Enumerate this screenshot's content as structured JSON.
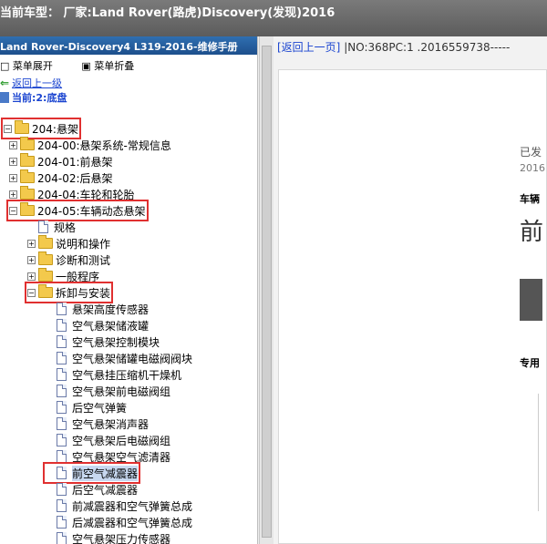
{
  "titlebar": {
    "text": "当前车型： 厂家:Land Rover(路虎)Discovery(发现)2016"
  },
  "left": {
    "header": "Land Rover-Discovery4 L319-2016-维修手册",
    "toolbar": {
      "expand": "菜单展开",
      "collapse": "菜单折叠"
    },
    "back_link": "返回上一级",
    "current": "当前:2:底盘",
    "tree": [
      {
        "label": "204:悬架",
        "type": "folder",
        "level": 0,
        "expanded": true
      },
      {
        "label": "204-00:悬架系统-常规信息",
        "type": "folder",
        "level": 1
      },
      {
        "label": "204-01:前悬架",
        "type": "folder",
        "level": 1
      },
      {
        "label": "204-02:后悬架",
        "type": "folder",
        "level": 1
      },
      {
        "label": "204-04:车轮和轮胎",
        "type": "folder",
        "level": 1
      },
      {
        "label": "204-05:车辆动态悬架",
        "type": "folder",
        "level": 1,
        "expanded": true
      },
      {
        "label": "规格",
        "type": "doc",
        "level": 2
      },
      {
        "label": "说明和操作",
        "type": "folder",
        "level": 2
      },
      {
        "label": "诊断和测试",
        "type": "folder",
        "level": 2
      },
      {
        "label": "一般程序",
        "type": "folder",
        "level": 2
      },
      {
        "label": "拆卸与安装",
        "type": "folder",
        "level": 2,
        "expanded": true
      },
      {
        "label": "悬架高度传感器",
        "type": "doc",
        "level": 3
      },
      {
        "label": "空气悬架储液罐",
        "type": "doc",
        "level": 3
      },
      {
        "label": "空气悬架控制模块",
        "type": "doc",
        "level": 3
      },
      {
        "label": "空气悬架储罐电磁阀阀块",
        "type": "doc",
        "level": 3
      },
      {
        "label": "空气悬挂压缩机干燥机",
        "type": "doc",
        "level": 3
      },
      {
        "label": "空气悬架前电磁阀组",
        "type": "doc",
        "level": 3
      },
      {
        "label": "后空气弹簧",
        "type": "doc",
        "level": 3
      },
      {
        "label": "空气悬架消声器",
        "type": "doc",
        "level": 3
      },
      {
        "label": "空气悬架后电磁阀组",
        "type": "doc",
        "level": 3
      },
      {
        "label": "空气悬架空气滤清器",
        "type": "doc",
        "level": 3
      },
      {
        "label": "前空气减震器",
        "type": "doc",
        "level": 3
      },
      {
        "label": "后空气减震器",
        "type": "doc",
        "level": 3
      },
      {
        "label": "前减震器和空气弹簧总成",
        "type": "doc",
        "level": 3
      },
      {
        "label": "后减震器和空气弹簧总成",
        "type": "doc",
        "level": 3
      },
      {
        "label": "空气悬架压力传感器",
        "type": "doc",
        "level": 3
      }
    ]
  },
  "right": {
    "back": "[返回上一页]",
    "info": "|NO:368PC:1 .2016559738-----",
    "p1": "已发",
    "p2": "2016",
    "p3": "车辆",
    "p4": "前",
    "p5": "专用"
  }
}
